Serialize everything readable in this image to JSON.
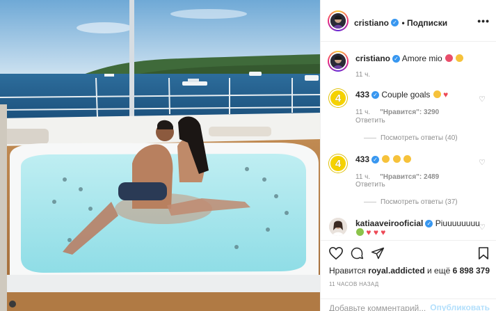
{
  "post": {
    "author": "cristiano",
    "follow_label": "• Подписки",
    "more_label": "•••",
    "image_alt": "Couple in hot tub on yacht deck",
    "caption": {
      "author": "cristiano",
      "text": "Amore mio",
      "time": "11 ч."
    },
    "comments": [
      {
        "author": "433",
        "text": "Couple goals",
        "time": "11 ч.",
        "likes": "\"Нравится\": 3290",
        "reply_label": "Ответить",
        "view_replies": "Посмотреть ответы (40)"
      },
      {
        "author": "433",
        "text": "",
        "time": "11 ч.",
        "likes": "\"Нравится\": 2489",
        "reply_label": "Ответить",
        "view_replies": "Посмотреть ответы (37)"
      },
      {
        "author": "katiaaveirooficial",
        "text": "Piuuuuuuuu"
      }
    ],
    "likes": {
      "prefix": "Нравится",
      "user": "royal.addicted",
      "suffix": "и ещё",
      "count": "6 898 379"
    },
    "time_ago": "11 ЧАСОВ НАЗАД",
    "comment_placeholder": "Добавьте комментарий...",
    "publish_label": "Опубликовать"
  },
  "colors": {
    "verified": "#3897f0",
    "accent_433": "#f5d200",
    "publish_disabled": "#b2dffc",
    "heart_red": "#ed4956"
  },
  "icons": [
    "heart-icon",
    "comment-icon",
    "share-icon",
    "bookmark-icon",
    "verified-icon",
    "more-icon"
  ]
}
